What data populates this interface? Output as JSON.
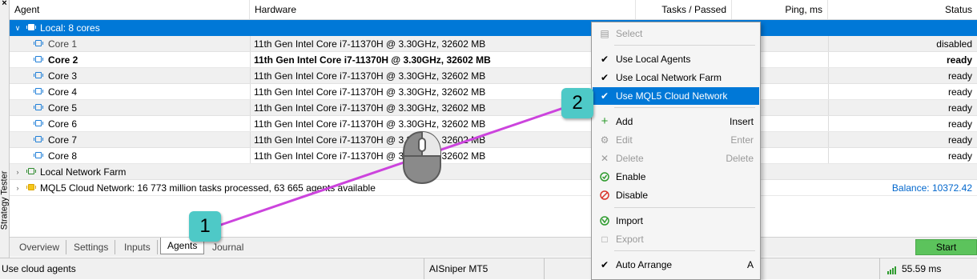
{
  "side_panel": {
    "title": "Strategy Tester",
    "close": "×"
  },
  "table": {
    "headers": {
      "agent": "Agent",
      "hardware": "Hardware",
      "tasks": "Tasks / Passed",
      "ping": "Ping, ms",
      "status": "Status"
    },
    "group_local": {
      "label": "Local: 8 cores"
    },
    "cores": [
      {
        "name": "Core 1",
        "hardware": "11th Gen Intel Core i7-11370H @ 3.30GHz, 32602 MB",
        "status": "disabled"
      },
      {
        "name": "Core 2",
        "hardware": "11th Gen Intel Core i7-11370H @ 3.30GHz, 32602 MB",
        "status": "ready"
      },
      {
        "name": "Core 3",
        "hardware": "11th Gen Intel Core i7-11370H @ 3.30GHz, 32602 MB",
        "status": "ready"
      },
      {
        "name": "Core 4",
        "hardware": "11th Gen Intel Core i7-11370H @ 3.30GHz, 32602 MB",
        "status": "ready"
      },
      {
        "name": "Core 5",
        "hardware": "11th Gen Intel Core i7-11370H @ 3.30GHz, 32602 MB",
        "status": "ready"
      },
      {
        "name": "Core 6",
        "hardware": "11th Gen Intel Core i7-11370H @ 3.30GHz, 32602 MB",
        "status": "ready"
      },
      {
        "name": "Core 7",
        "hardware": "11th Gen Intel Core i7-11370H @ 3.30GHz, 32602 MB",
        "status": "ready"
      },
      {
        "name": "Core 8",
        "hardware": "11th Gen Intel Core i7-11370H @ 3.30GHz, 32602 MB",
        "status": "ready"
      }
    ],
    "group_farm": {
      "label": "Local Network Farm"
    },
    "group_cloud": {
      "label": "MQL5 Cloud Network: 16 773 million tasks processed, 63 665 agents available",
      "balance": "Balance: 10372.42"
    }
  },
  "tabs": {
    "items": [
      "Overview",
      "Settings",
      "Inputs",
      "Agents",
      "Journal"
    ],
    "active": "Agents",
    "start": "Start"
  },
  "status_bar": {
    "hint": "Use cloud agents",
    "program": "AISniper MT5",
    "ping": "55.59 ms"
  },
  "context_menu": {
    "select": "Select",
    "use_local": "Use Local Agents",
    "use_farm": "Use Local Network Farm",
    "use_cloud": "Use MQL5 Cloud Network",
    "add": "Add",
    "add_key": "Insert",
    "edit": "Edit",
    "edit_key": "Enter",
    "delete": "Delete",
    "delete_key": "Delete",
    "enable": "Enable",
    "disable": "Disable",
    "import": "Import",
    "export": "Export",
    "auto_arrange": "Auto Arrange",
    "auto_arrange_key": "A"
  },
  "annotations": {
    "step1": "1",
    "step2": "2",
    "line_color": "#cc44dd",
    "badge_color": "#4ec9c7"
  },
  "colors": {
    "selection": "#0078d7",
    "start_button": "#5cc35c",
    "core_icon": "#1f7fd8"
  }
}
